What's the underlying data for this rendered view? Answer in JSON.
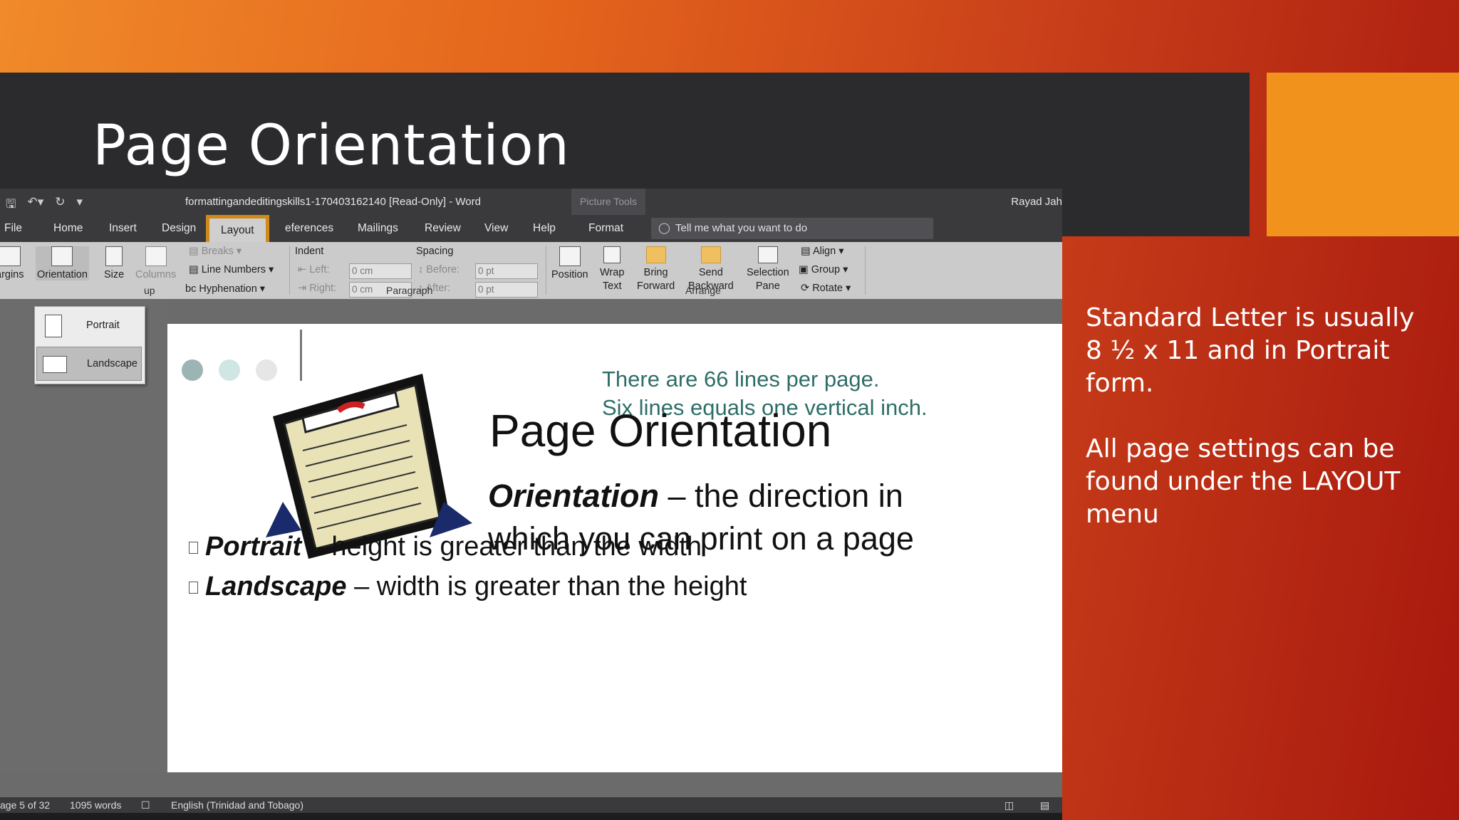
{
  "slide": {
    "title": "Page Orientation",
    "side_text_1": "Standard Letter is usually 8 ½ x 11 and in Portrait form.",
    "side_text_2": "All page settings can be found under the LAYOUT menu"
  },
  "word": {
    "title": "formattingandeditingskills1-170403162140 [Read-Only]  -  Word",
    "picture_tools": "Picture Tools",
    "user": "Rayad Jah",
    "tabs": [
      "File",
      "Home",
      "Insert",
      "Design",
      "Layout",
      "eferences",
      "Mailings",
      "Review",
      "View",
      "Help",
      "Format"
    ],
    "active_tab": "Layout",
    "tell_me": "Tell me what you want to do",
    "ribbon": {
      "margins": "argins",
      "orientation": "Orientation",
      "size": "Size",
      "columns": "Columns",
      "breaks": "Breaks",
      "line_numbers": "Line Numbers",
      "hyphenation": "Hyphenation",
      "group_page_setup": "up",
      "indent": "Indent",
      "spacing": "Spacing",
      "left_label": "Left:",
      "right_label": "Right:",
      "before_label": "Before:",
      "after_label": "After:",
      "left_value": "0 cm",
      "right_value": "0 cm",
      "before_value": "0 pt",
      "after_value": "0 pt",
      "group_paragraph": "Paragraph",
      "position": "Position",
      "wrap_text_1": "Wrap",
      "wrap_text_2": "Text",
      "bring_forward_1": "Bring",
      "bring_forward_2": "Forward",
      "send_backward_1": "Send",
      "send_backward_2": "Backward",
      "selection_pane_1": "Selection",
      "selection_pane_2": "Pane",
      "align": "Align",
      "group": "Group",
      "rotate": "Rotate",
      "group_arrange": "Arrange"
    },
    "orientation_menu": {
      "portrait": "Portrait",
      "landscape": "Landscape",
      "selected": "Landscape"
    },
    "status": {
      "page": "age 5 of 32",
      "words": "1095 words",
      "language": "English (Trinidad and Tobago)"
    },
    "document": {
      "green_line_1": "There are 66 lines per page.",
      "green_line_2": "Six lines equals one vertical inch.",
      "heading": "Page Orientation",
      "orientation_term": "Orientation",
      "orientation_def_1": " – the direction in",
      "orientation_def_2": "which you can print on a page",
      "portrait_term": "Portrait",
      "portrait_def": " – height is greater than the width",
      "landscape_term": "Landscape",
      "landscape_def": " – width is greater than the height"
    }
  },
  "colors": {
    "accent_orange": "#f0921c",
    "tab_highlight": "#d08a1a",
    "green_text": "#2e6e68"
  }
}
